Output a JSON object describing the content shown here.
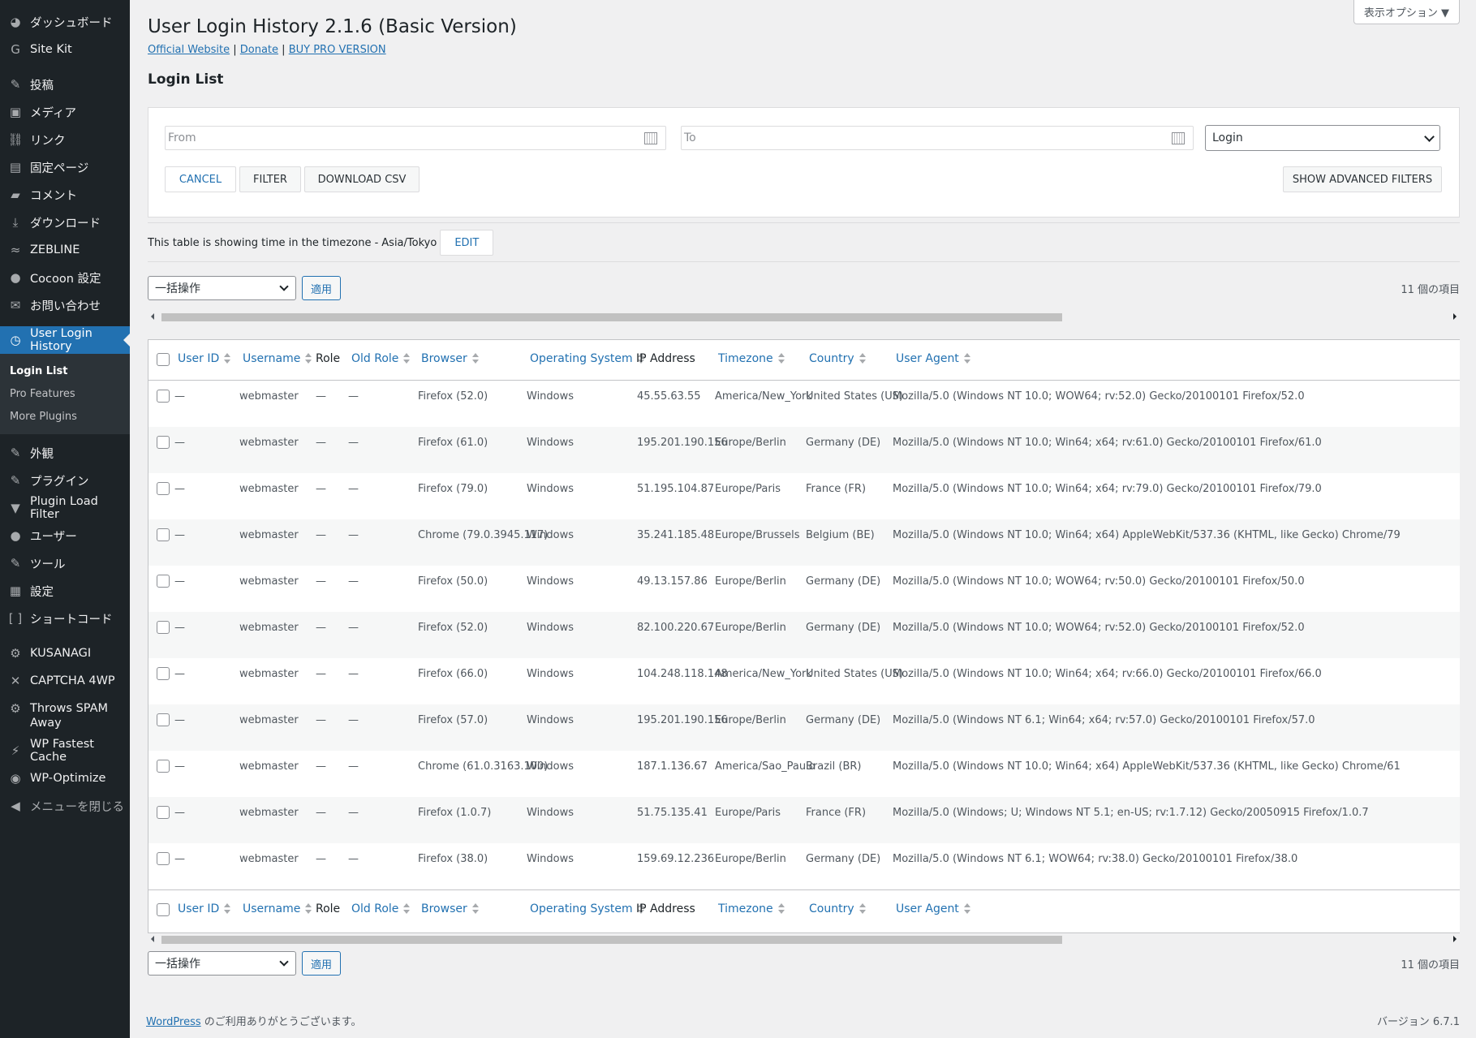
{
  "sidebar": {
    "items": [
      {
        "label": "ダッシュボード",
        "icon": "dashboard-icon",
        "glyph": "◕"
      },
      {
        "label": "Site Kit",
        "icon": "site-kit-icon",
        "glyph": "G"
      },
      {
        "label": "投稿",
        "icon": "pin-icon",
        "glyph": "✎"
      },
      {
        "label": "メディア",
        "icon": "media-icon",
        "glyph": "▣"
      },
      {
        "label": "リンク",
        "icon": "link-icon",
        "glyph": "⛓"
      },
      {
        "label": "固定ページ",
        "icon": "pages-icon",
        "glyph": "▤"
      },
      {
        "label": "コメント",
        "icon": "comment-icon",
        "glyph": "▰"
      },
      {
        "label": "ダウンロード",
        "icon": "download-icon",
        "glyph": "⤓"
      },
      {
        "label": "ZEBLINE",
        "icon": "zebline-icon",
        "glyph": "≈"
      },
      {
        "label": "Cocoon 設定",
        "icon": "cocoon-icon",
        "glyph": "●"
      },
      {
        "label": "お問い合わせ",
        "icon": "mail-icon",
        "glyph": "✉"
      },
      {
        "label": "User Login History",
        "icon": "clock-icon",
        "glyph": "◷"
      }
    ],
    "submenu": [
      {
        "label": "Login List"
      },
      {
        "label": "Pro Features"
      },
      {
        "label": "More Plugins"
      }
    ],
    "items2": [
      {
        "label": "外観",
        "icon": "appearance-icon",
        "glyph": "✎"
      },
      {
        "label": "プラグイン",
        "icon": "plugin-icon",
        "glyph": "✎"
      },
      {
        "label": "Plugin Load Filter",
        "icon": "filter-icon",
        "glyph": "▼"
      },
      {
        "label": "ユーザー",
        "icon": "user-icon",
        "glyph": "●"
      },
      {
        "label": "ツール",
        "icon": "tools-icon",
        "glyph": "✎"
      },
      {
        "label": "設定",
        "icon": "settings-icon",
        "glyph": "▦"
      },
      {
        "label": "ショートコード",
        "icon": "shortcode-icon",
        "glyph": "[ ]"
      }
    ],
    "items3": [
      {
        "label": "KUSANAGI",
        "icon": "kusanagi-gear-icon",
        "glyph": "⚙"
      },
      {
        "label": "CAPTCHA 4WP",
        "icon": "captcha-icon",
        "glyph": "✕"
      },
      {
        "label": "Throws SPAM Away",
        "icon": "spam-gear-icon",
        "glyph": "⚙"
      },
      {
        "label": "WP Fastest Cache",
        "icon": "cheetah-icon",
        "glyph": "⚡"
      },
      {
        "label": "WP-Optimize",
        "icon": "optimize-icon",
        "glyph": "◉"
      },
      {
        "label": "メニューを閉じる",
        "icon": "collapse-icon",
        "glyph": "◀"
      }
    ]
  },
  "header": {
    "screen_options": "表示オプション ▼",
    "title": "User Login History 2.1.6 (Basic Version)",
    "link_official": "Official Website",
    "sep": "|",
    "link_donate": "Donate",
    "link_pro": "BUY PRO VERSION",
    "section": "Login List"
  },
  "filters": {
    "from_placeholder": "From",
    "to_placeholder": "To",
    "type_value": "Login",
    "cancel": "CANCEL",
    "filter": "FILTER",
    "download": "DOWNLOAD CSV",
    "advanced": "SHOW ADVANCED FILTERS"
  },
  "timezone": {
    "text": "This table is showing time in the timezone -",
    "value": "Asia/Tokyo",
    "edit": "EDIT"
  },
  "bulk": {
    "action": "一括操作",
    "apply": "適用",
    "count": "11 個の項目"
  },
  "columns": {
    "user_id": "User ID",
    "username": "Username",
    "role": "Role",
    "old_role": "Old Role",
    "browser": "Browser",
    "os": "Operating System",
    "ip": "IP Address",
    "timezone": "Timezone",
    "country": "Country",
    "user_agent": "User Agent"
  },
  "rows": [
    {
      "user_id": "—",
      "username": "webmaster",
      "role": "—",
      "old_role": "—",
      "browser": "Firefox (52.0)",
      "os": "Windows",
      "ip": "45.55.63.55",
      "timezone": "America/New_York",
      "country": "United States (US)",
      "ua": "Mozilla/5.0 (Windows NT 10.0; WOW64; rv:52.0) Gecko/20100101 Firefox/52.0"
    },
    {
      "user_id": "—",
      "username": "webmaster",
      "role": "—",
      "old_role": "—",
      "browser": "Firefox (61.0)",
      "os": "Windows",
      "ip": "195.201.190.156",
      "timezone": "Europe/Berlin",
      "country": "Germany (DE)",
      "ua": "Mozilla/5.0 (Windows NT 10.0; Win64; x64; rv:61.0) Gecko/20100101 Firefox/61.0"
    },
    {
      "user_id": "—",
      "username": "webmaster",
      "role": "—",
      "old_role": "—",
      "browser": "Firefox (79.0)",
      "os": "Windows",
      "ip": "51.195.104.87",
      "timezone": "Europe/Paris",
      "country": "France (FR)",
      "ua": "Mozilla/5.0 (Windows NT 10.0; Win64; x64; rv:79.0) Gecko/20100101 Firefox/79.0"
    },
    {
      "user_id": "—",
      "username": "webmaster",
      "role": "—",
      "old_role": "—",
      "browser": "Chrome (79.0.3945.117)",
      "os": "Windows",
      "ip": "35.241.185.48",
      "timezone": "Europe/Brussels",
      "country": "Belgium (BE)",
      "ua": "Mozilla/5.0 (Windows NT 10.0; Win64; x64) AppleWebKit/537.36 (KHTML, like Gecko) Chrome/79"
    },
    {
      "user_id": "—",
      "username": "webmaster",
      "role": "—",
      "old_role": "—",
      "browser": "Firefox (50.0)",
      "os": "Windows",
      "ip": "49.13.157.86",
      "timezone": "Europe/Berlin",
      "country": "Germany (DE)",
      "ua": "Mozilla/5.0 (Windows NT 10.0; WOW64; rv:50.0) Gecko/20100101 Firefox/50.0"
    },
    {
      "user_id": "—",
      "username": "webmaster",
      "role": "—",
      "old_role": "—",
      "browser": "Firefox (52.0)",
      "os": "Windows",
      "ip": "82.100.220.67",
      "timezone": "Europe/Berlin",
      "country": "Germany (DE)",
      "ua": "Mozilla/5.0 (Windows NT 10.0; WOW64; rv:52.0) Gecko/20100101 Firefox/52.0"
    },
    {
      "user_id": "—",
      "username": "webmaster",
      "role": "—",
      "old_role": "—",
      "browser": "Firefox (66.0)",
      "os": "Windows",
      "ip": "104.248.118.148",
      "timezone": "America/New_York",
      "country": "United States (US)",
      "ua": "Mozilla/5.0 (Windows NT 10.0; Win64; x64; rv:66.0) Gecko/20100101 Firefox/66.0"
    },
    {
      "user_id": "—",
      "username": "webmaster",
      "role": "—",
      "old_role": "—",
      "browser": "Firefox (57.0)",
      "os": "Windows",
      "ip": "195.201.190.156",
      "timezone": "Europe/Berlin",
      "country": "Germany (DE)",
      "ua": "Mozilla/5.0 (Windows NT 6.1; Win64; x64; rv:57.0) Gecko/20100101 Firefox/57.0"
    },
    {
      "user_id": "—",
      "username": "webmaster",
      "role": "—",
      "old_role": "—",
      "browser": "Chrome (61.0.3163.100)",
      "os": "Windows",
      "ip": "187.1.136.67",
      "timezone": "America/Sao_Paulo",
      "country": "Brazil (BR)",
      "ua": "Mozilla/5.0 (Windows NT 10.0; Win64; x64) AppleWebKit/537.36 (KHTML, like Gecko) Chrome/61"
    },
    {
      "user_id": "—",
      "username": "webmaster",
      "role": "—",
      "old_role": "—",
      "browser": "Firefox (1.0.7)",
      "os": "Windows",
      "ip": "51.75.135.41",
      "timezone": "Europe/Paris",
      "country": "France (FR)",
      "ua": "Mozilla/5.0 (Windows; U; Windows NT 5.1; en-US; rv:1.7.12) Gecko/20050915 Firefox/1.0.7"
    },
    {
      "user_id": "—",
      "username": "webmaster",
      "role": "—",
      "old_role": "—",
      "browser": "Firefox (38.0)",
      "os": "Windows",
      "ip": "159.69.12.236",
      "timezone": "Europe/Berlin",
      "country": "Germany (DE)",
      "ua": "Mozilla/5.0 (Windows NT 6.1; WOW64; rv:38.0) Gecko/20100101 Firefox/38.0"
    }
  ],
  "footer": {
    "wp_link": "WordPress",
    "thanks": " のご利用ありがとうございます。",
    "version": "バージョン 6.7.1"
  }
}
